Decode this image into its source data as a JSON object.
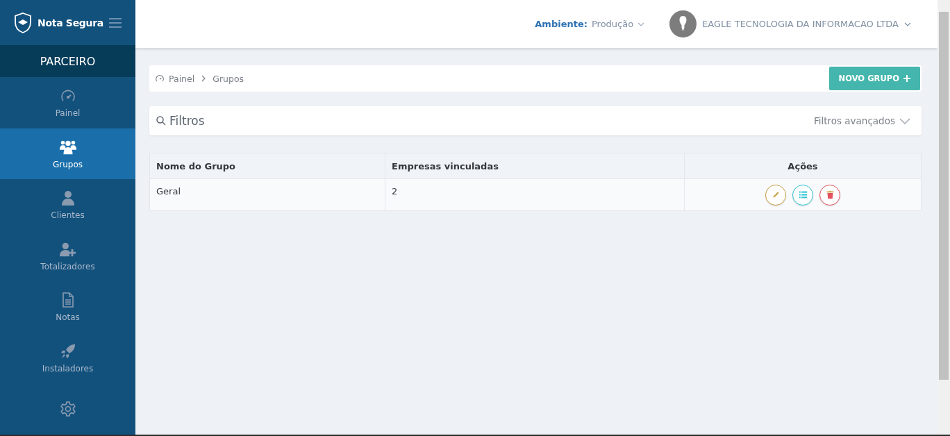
{
  "brand": {
    "name": "Nota Segura"
  },
  "sidebar": {
    "section": "PARCEIRO",
    "items": [
      {
        "kind": "gauge",
        "label": "Painel",
        "selected": false
      },
      {
        "kind": "users",
        "label": "Grupos",
        "selected": true
      },
      {
        "kind": "user",
        "label": "Clientes",
        "selected": false
      },
      {
        "kind": "user-plus",
        "label": "Totalizadores",
        "selected": false
      },
      {
        "kind": "file",
        "label": "Notas",
        "selected": false
      },
      {
        "kind": "rocket",
        "label": "Instaladores",
        "selected": false
      },
      {
        "kind": "gear",
        "selected": false
      }
    ]
  },
  "header": {
    "environment_label": "Ambiente:",
    "environment": "Produção",
    "company": "EAGLE TECNOLOGIA DA INFORMACAO LTDA"
  },
  "breadcrumb": [
    "Painel",
    "Grupos"
  ],
  "new_button": "NOVO GRUPO",
  "filters": {
    "title": "Filtros",
    "advanced": "Filtros avançados"
  },
  "table": {
    "columns": [
      "Nome do Grupo",
      "Empresas vinculadas",
      "Ações"
    ],
    "rows": [
      {
        "name": "Geral",
        "companies": "2",
        "actions": [
          {
            "kind": "edit"
          },
          {
            "kind": "list"
          },
          {
            "kind": "delete"
          }
        ]
      }
    ]
  }
}
